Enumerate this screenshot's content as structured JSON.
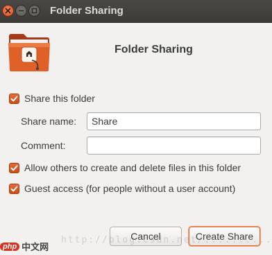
{
  "window": {
    "title": "Folder Sharing"
  },
  "header": {
    "title": "Folder Sharing",
    "icon": "shared-folder-icon"
  },
  "form": {
    "share_folder_label": "Share this folder",
    "share_folder_checked": true,
    "share_name_label": "Share name:",
    "share_name_value": "Share",
    "comment_label": "Comment:",
    "comment_value": "",
    "allow_others_label": "Allow others to create and delete files in this folder",
    "allow_others_checked": true,
    "guest_access_label": "Guest access (for people without a user account)",
    "guest_access_checked": true
  },
  "buttons": {
    "cancel_label": "Cancel",
    "create_label": "Create Share"
  },
  "overlay": {
    "watermark": "http://blog.csdn.net/..........",
    "logo_php": "php",
    "logo_cn": "中文网"
  },
  "colors": {
    "accent": "#dd5a22",
    "titlebar": "#3c3b37",
    "background": "#f2f1f0"
  }
}
